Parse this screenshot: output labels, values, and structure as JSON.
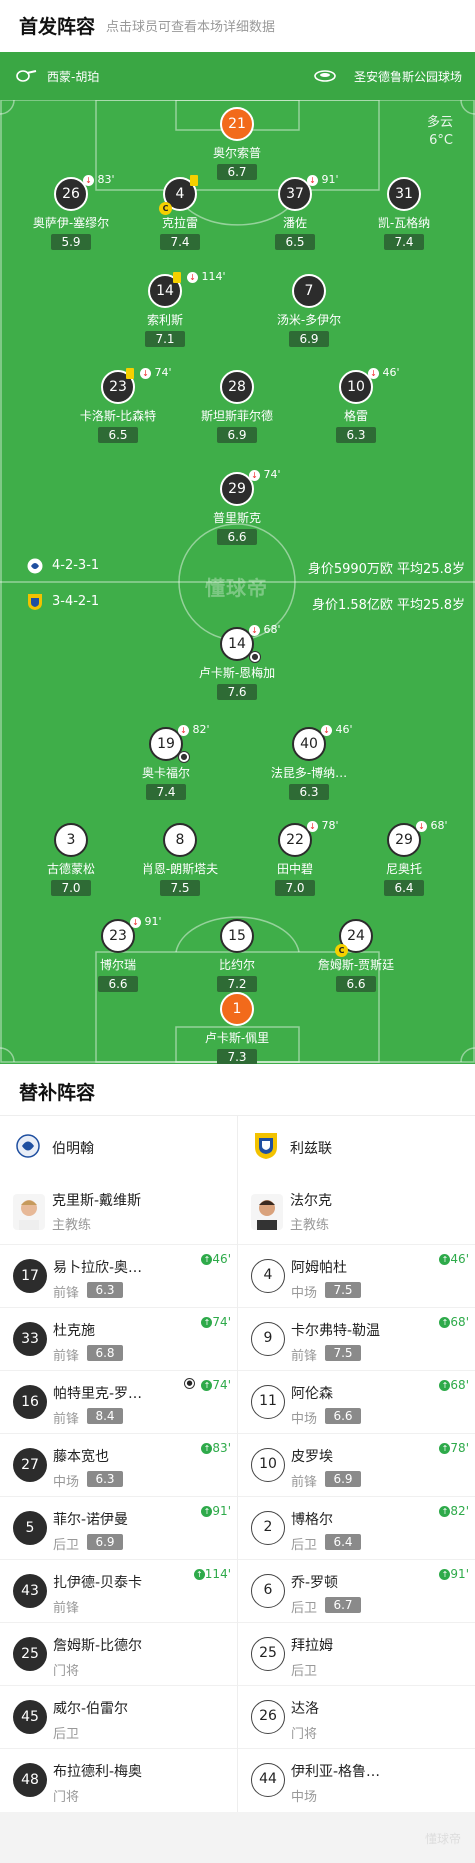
{
  "header": {
    "title": "首发阵容",
    "subtitle": "点击球员可查看本场详细数据"
  },
  "pitch_info": {
    "referee": "西蒙-胡珀",
    "stadium": "圣安德鲁斯公园球场",
    "weather": "多云",
    "temperature": "6°C",
    "watermark": "懂球帝"
  },
  "home_formation": {
    "formation": "4-2-3-1",
    "value_label": "身价5990万欧  平均25.8岁"
  },
  "away_formation": {
    "formation": "3-4-2-1",
    "value_label": "身价1.58亿欧  平均25.8岁"
  },
  "home_players": [
    {
      "number": "21",
      "name": "奥尔索普",
      "rating": "6.7"
    },
    {
      "number": "26",
      "name": "奥萨伊-塞缪尔",
      "rating": "5.9",
      "sub_minute": "83'"
    },
    {
      "number": "4",
      "name": "克拉雷",
      "rating": "7.4",
      "captain": "C"
    },
    {
      "number": "37",
      "name": "潘佐",
      "rating": "6.5",
      "sub_minute": "91'"
    },
    {
      "number": "31",
      "name": "凯-瓦格纳",
      "rating": "7.4"
    },
    {
      "number": "14",
      "name": "索利斯",
      "rating": "7.1",
      "sub_minute": "114'"
    },
    {
      "number": "7",
      "name": "汤米-多伊尔",
      "rating": "6.9"
    },
    {
      "number": "23",
      "name": "卡洛斯-比森特",
      "rating": "6.5",
      "sub_minute": "74'"
    },
    {
      "number": "28",
      "name": "斯坦斯菲尔德",
      "rating": "6.9"
    },
    {
      "number": "10",
      "name": "格雷",
      "rating": "6.3",
      "sub_minute": "46'"
    },
    {
      "number": "29",
      "name": "普里斯克",
      "rating": "6.6",
      "sub_minute": "74'"
    }
  ],
  "away_players": [
    {
      "number": "14",
      "name": "卢卡斯-恩梅加",
      "rating": "7.6",
      "sub_minute": "68'"
    },
    {
      "number": "19",
      "name": "奥卡福尔",
      "rating": "7.4",
      "sub_minute": "82'"
    },
    {
      "number": "40",
      "name": "法昆多-博纳…",
      "rating": "6.3",
      "sub_minute": "46'"
    },
    {
      "number": "3",
      "name": "古德蒙松",
      "rating": "7.0"
    },
    {
      "number": "8",
      "name": "肖恩-朗斯塔夫",
      "rating": "7.5"
    },
    {
      "number": "22",
      "name": "田中碧",
      "rating": "7.0",
      "sub_minute": "78'"
    },
    {
      "number": "29",
      "name": "尼奥托",
      "rating": "6.4",
      "sub_minute": "68'"
    },
    {
      "number": "23",
      "name": "博尔瑞",
      "rating": "6.6",
      "sub_minute": "91'"
    },
    {
      "number": "15",
      "name": "比约尔",
      "rating": "7.2"
    },
    {
      "number": "24",
      "name": "詹姆斯-贾斯廷",
      "rating": "6.6",
      "captain": "C"
    },
    {
      "number": "1",
      "name": "卢卡斯-佩里",
      "rating": "7.3"
    }
  ],
  "substitutes": {
    "title": "替补阵容",
    "home": {
      "team": "伯明翰",
      "coach": {
        "name": "克里斯-戴维斯",
        "role": "主教练"
      },
      "players": [
        {
          "number": "17",
          "name": "易卜拉欣-奥…",
          "pos": "前锋",
          "rating": "6.3",
          "minute": "46'"
        },
        {
          "number": "33",
          "name": "杜克施",
          "pos": "前锋",
          "rating": "6.8",
          "minute": "74'"
        },
        {
          "number": "16",
          "name": "帕特里克-罗…",
          "pos": "前锋",
          "rating": "8.4",
          "minute": "74'"
        },
        {
          "number": "27",
          "name": "藤本宽也",
          "pos": "中场",
          "rating": "6.3",
          "minute": "83'"
        },
        {
          "number": "5",
          "name": "菲尔-诺伊曼",
          "pos": "后卫",
          "rating": "6.9",
          "minute": "91'"
        },
        {
          "number": "43",
          "name": "扎伊德-贝泰卡",
          "pos": "前锋",
          "rating": "",
          "minute": "114'"
        },
        {
          "number": "25",
          "name": "詹姆斯-比德尔",
          "pos": "门将",
          "rating": "",
          "minute": ""
        },
        {
          "number": "45",
          "name": "威尔-伯雷尔",
          "pos": "后卫",
          "rating": "",
          "minute": ""
        },
        {
          "number": "48",
          "name": "布拉德利-梅奥",
          "pos": "门将",
          "rating": "",
          "minute": ""
        }
      ]
    },
    "away": {
      "team": "利兹联",
      "coach": {
        "name": "法尔克",
        "role": "主教练"
      },
      "players": [
        {
          "number": "4",
          "name": "阿姆帕杜",
          "pos": "中场",
          "rating": "7.5",
          "minute": "46'"
        },
        {
          "number": "9",
          "name": "卡尔弗特-勒温",
          "pos": "前锋",
          "rating": "7.5",
          "minute": "68'"
        },
        {
          "number": "11",
          "name": "阿伦森",
          "pos": "中场",
          "rating": "6.6",
          "minute": "68'"
        },
        {
          "number": "10",
          "name": "皮罗埃",
          "pos": "前锋",
          "rating": "6.9",
          "minute": "78'"
        },
        {
          "number": "2",
          "name": "博格尔",
          "pos": "后卫",
          "rating": "6.4",
          "minute": "82'"
        },
        {
          "number": "6",
          "name": "乔-罗顿",
          "pos": "后卫",
          "rating": "6.7",
          "minute": "91'"
        },
        {
          "number": "25",
          "name": "拜拉姆",
          "pos": "后卫",
          "rating": "",
          "minute": ""
        },
        {
          "number": "26",
          "name": "达洛",
          "pos": "门将",
          "rating": "",
          "minute": ""
        },
        {
          "number": "44",
          "name": "伊利亚-格鲁…",
          "pos": "中场",
          "rating": "",
          "minute": ""
        }
      ]
    }
  },
  "footer": {
    "watermark": "懂球帝"
  },
  "colors": {
    "pitch": "#3fae49",
    "home_kit": "#2c2c2c",
    "away_kit": "#ffffff",
    "goalkeeper": "#f26a1b",
    "sub_in": "#2eaa4a"
  }
}
